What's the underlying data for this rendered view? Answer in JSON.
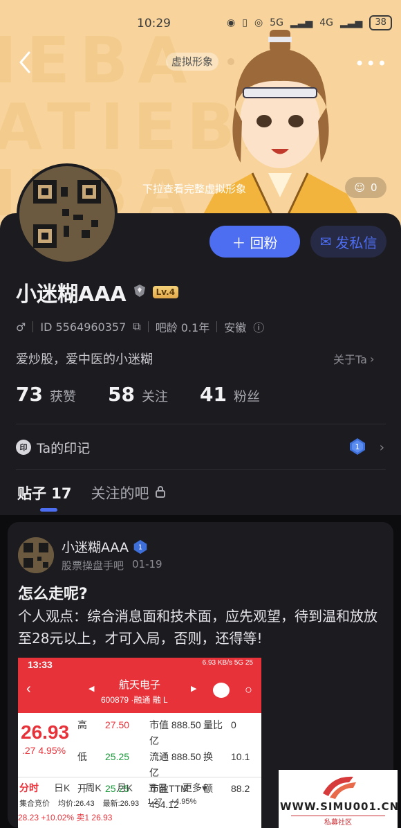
{
  "status_bar": {
    "time": "10:29",
    "battery": "38",
    "network": "5G",
    "network2": "4G"
  },
  "banner": {
    "virtual_avatar_tag": "虚拟形象",
    "pull_hint": "下拉查看完整虚拟形象",
    "like_count": "0"
  },
  "profile": {
    "username": "小迷糊AAA",
    "level": "Lv.4",
    "gender_icon": "male-icon",
    "id_text": "ID 5564960357",
    "bar_age": "吧龄 0.1年",
    "location": "安徽",
    "bio": "爱炒股，爱中医的小迷糊",
    "about_link": "关于Ta",
    "follow_back_label": "回粉",
    "message_label": "发私信",
    "stats": [
      {
        "num": "73",
        "label": "获赞"
      },
      {
        "num": "58",
        "label": "关注"
      },
      {
        "num": "41",
        "label": "粉丝"
      }
    ],
    "imprint_icon_text": "印",
    "imprint_label": "Ta的印记",
    "imprint_badge": "1"
  },
  "tabs": [
    {
      "label": "贴子 17",
      "active": true
    },
    {
      "label": "关注的吧",
      "locked": true
    }
  ],
  "post": {
    "author": "小迷糊AAA",
    "author_badge": "1",
    "forum": "股票操盘手吧",
    "date": "01-19",
    "title": "怎么走呢?",
    "body": "个人观点：综合消息面和技术面，应先观望，待到温和放放至28元以上，才可入局，否则，还得等!"
  },
  "stock_screenshot": {
    "time": "13:33",
    "status": "6.93 KB/s 5G 25",
    "name": "航天电子",
    "code": "600879 ·融通 融 L",
    "price": "26.93",
    "change": ".27  4.95%",
    "grid": [
      [
        "高",
        "27.50",
        "市值 888.50亿",
        "量比",
        "0"
      ],
      [
        "低",
        "25.25",
        "流通 888.50亿",
        "换",
        "10.1"
      ],
      [
        "开",
        "25.25",
        "市盈TTM 454.12",
        "额",
        "88.2"
      ]
    ],
    "tabs": [
      "分时",
      "日K",
      "周K",
      "月K",
      "五日",
      "更多▾"
    ],
    "row2": [
      "集合竞价",
      "均价:26.43",
      "最新:26.93",
      "1.27",
      "+4.95%"
    ],
    "row3": "28.23       +10.02%     卖1  26.93"
  },
  "watermark": {
    "url": "WWW.SIMU001.CN",
    "sub": "私募社区"
  },
  "colors": {
    "accent": "#4e6ef2",
    "banner_bg": "#f8d49c",
    "sheet_bg": "#1c1c20",
    "stock_red": "#e8323a"
  }
}
